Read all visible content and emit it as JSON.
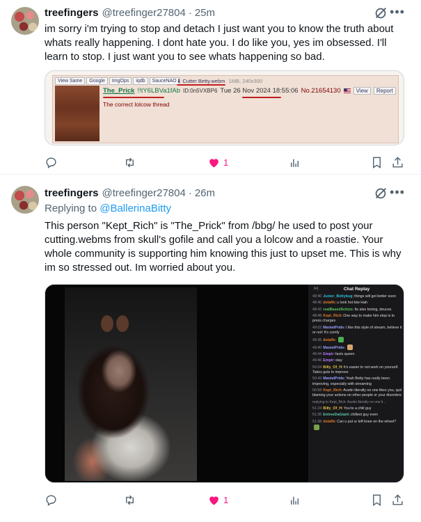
{
  "tweets": [
    {
      "display_name": "treefingers",
      "handle": "@treefinger27804",
      "time": "25m",
      "text": "im sorry i'm trying to stop and detach I just want you to know the truth about whats really happening. I dont hate you. I do like you, yes im obsessed. I'll learn to stop. I just want you to see whats happening so bad.",
      "like_count": "1",
      "embed": {
        "tool_links": [
          "View Same",
          "Google",
          "ImgOps",
          "iqdb",
          "SauceNAO"
        ],
        "file_name": "Cutter Betty.webm",
        "file_size": "1MB, 240x300",
        "poster_name": "The_Prick",
        "tripcode": "!!tY6LBVa1fAb",
        "poster_id": "ID:0n5VXBP6",
        "date": "Tue 26 Nov 2024 18:55:06",
        "post_no": "No.21654130",
        "view_label": "View",
        "report_label": "Report",
        "comment": "The correct lolcow thread"
      }
    },
    {
      "display_name": "treefingers",
      "handle": "@treefinger27804",
      "time": "26m",
      "replying_prefix": "Replying to",
      "replying_to": "@BallerinaBitty",
      "text": "This person \"Kept_Rich\" is \"The_Prick\" from /bbg/ he used to post your cutting.webms from skull's gofile and call you a lolcow and a roastie. Your whole community is supporting him knowing this just to upset me. This is why im so stressed out. Im worried about you.",
      "like_count": "1",
      "chat": {
        "title": "Chat Replay",
        "messages": [
          {
            "ts": "48:40",
            "user": "Junior_Bettybug:",
            "color": "#2fbfd8",
            "text": "things will get better soon"
          },
          {
            "ts": "48:40",
            "user": "dolafik:",
            "color": "#e07b2a",
            "text": "u look hot btw Hah"
          },
          {
            "ts": "48:42",
            "user": "realBasedSchizo:",
            "color": "#5ac85a",
            "text": "Its also boring, deuces"
          },
          {
            "ts": "48:48",
            "user": "Kept_Rich:",
            "color": "#e07b2a",
            "text": "One way to make him stop is to press charges"
          },
          {
            "ts": "49:02",
            "user": "ManietPride:",
            "color": "#9aa0ff",
            "text": "I like this style of stream, believe it or not! It's comfy"
          },
          {
            "ts": "49:36",
            "user": "dolafik:",
            "color": "#e07b2a",
            "text": ""
          },
          {
            "ts": "49:40",
            "user": "ManietPride:",
            "color": "#9aa0ff",
            "text": ""
          },
          {
            "ts": "49:44",
            "user": "Empir:",
            "color": "#b77cff",
            "text": "facts queen"
          },
          {
            "ts": "49:46",
            "user": "Empir:",
            "color": "#b77cff",
            "text": "stay"
          },
          {
            "ts": "50:04",
            "user": "Billy_Of_H:",
            "color": "#e0c040",
            "text": "It's easier to not work on yourself. Takes guts to improve"
          },
          {
            "ts": "50:43",
            "user": "ManietPride:",
            "color": "#9aa0ff",
            "text": "Yeah Betty has really been improving, especially with streaming"
          },
          {
            "ts": "50:58",
            "user": "Kept_Rich:",
            "color": "#e07b2a",
            "text": "Austin literally no one likes you, quit blaming your actions on other people or your disorders"
          },
          {
            "ts": "",
            "user": "",
            "color": "#8e8e97",
            "text": "replying to Kept_Rich: Austin literally no one li..."
          },
          {
            "ts": "51:24",
            "user": "Billy_Of_H:",
            "color": "#e0c040",
            "text": "You're a chill guy"
          },
          {
            "ts": "51:36",
            "user": "EntreeDaGiant:",
            "color": "#5ac8a0",
            "text": "chillest guy even"
          },
          {
            "ts": "51:38",
            "user": "dolafik:",
            "color": "#e07b2a",
            "text": "Can u put ur left knee on the wheel?"
          }
        ]
      }
    }
  ],
  "icons": {
    "grok": "grok-icon",
    "more": "more-icon",
    "reply": "reply-icon",
    "retweet": "retweet-icon",
    "like": "heart-icon",
    "views": "analytics-icon",
    "bookmark": "bookmark-icon",
    "share": "share-icon"
  },
  "colors": {
    "like_active": "#f91880",
    "link": "#1d9bf0",
    "secondary_text": "#536471",
    "chan_name_green": "#117743",
    "annotation_red": "#c02020"
  }
}
